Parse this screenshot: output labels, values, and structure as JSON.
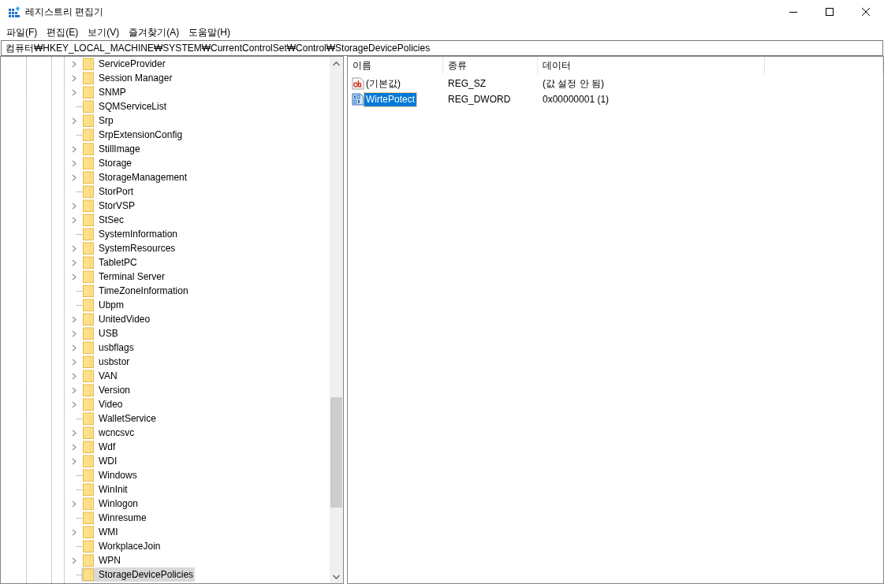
{
  "window": {
    "title": "레지스트리 편집기"
  },
  "menu": [
    "파일(F)",
    "편집(E)",
    "보기(V)",
    "즐겨찾기(A)",
    "도움말(H)"
  ],
  "address": "컴퓨터₩HKEY_LOCAL_MACHINE₩SYSTEM₩CurrentControlSet₩Control₩StorageDevicePolicies",
  "tree": [
    {
      "label": "ServiceProvider",
      "expandable": true,
      "selected": false
    },
    {
      "label": "Session Manager",
      "expandable": true,
      "selected": false
    },
    {
      "label": "SNMP",
      "expandable": true,
      "selected": false
    },
    {
      "label": "SQMServiceList",
      "expandable": false,
      "selected": false
    },
    {
      "label": "Srp",
      "expandable": true,
      "selected": false
    },
    {
      "label": "SrpExtensionConfig",
      "expandable": false,
      "selected": false
    },
    {
      "label": "StillImage",
      "expandable": true,
      "selected": false
    },
    {
      "label": "Storage",
      "expandable": true,
      "selected": false
    },
    {
      "label": "StorageManagement",
      "expandable": true,
      "selected": false
    },
    {
      "label": "StorPort",
      "expandable": false,
      "selected": false
    },
    {
      "label": "StorVSP",
      "expandable": true,
      "selected": false
    },
    {
      "label": "StSec",
      "expandable": true,
      "selected": false
    },
    {
      "label": "SystemInformation",
      "expandable": false,
      "selected": false
    },
    {
      "label": "SystemResources",
      "expandable": true,
      "selected": false
    },
    {
      "label": "TabletPC",
      "expandable": true,
      "selected": false
    },
    {
      "label": "Terminal Server",
      "expandable": true,
      "selected": false
    },
    {
      "label": "TimeZoneInformation",
      "expandable": false,
      "selected": false
    },
    {
      "label": "Ubpm",
      "expandable": false,
      "selected": false
    },
    {
      "label": "UnitedVideo",
      "expandable": true,
      "selected": false
    },
    {
      "label": "USB",
      "expandable": true,
      "selected": false
    },
    {
      "label": "usbflags",
      "expandable": true,
      "selected": false
    },
    {
      "label": "usbstor",
      "expandable": true,
      "selected": false
    },
    {
      "label": "VAN",
      "expandable": true,
      "selected": false
    },
    {
      "label": "Version",
      "expandable": true,
      "selected": false
    },
    {
      "label": "Video",
      "expandable": true,
      "selected": false
    },
    {
      "label": "WalletService",
      "expandable": false,
      "selected": false
    },
    {
      "label": "wcncsvc",
      "expandable": true,
      "selected": false
    },
    {
      "label": "Wdf",
      "expandable": true,
      "selected": false
    },
    {
      "label": "WDI",
      "expandable": true,
      "selected": false
    },
    {
      "label": "Windows",
      "expandable": false,
      "selected": false
    },
    {
      "label": "WinInit",
      "expandable": false,
      "selected": false
    },
    {
      "label": "Winlogon",
      "expandable": true,
      "selected": false
    },
    {
      "label": "Winresume",
      "expandable": false,
      "selected": false
    },
    {
      "label": "WMI",
      "expandable": true,
      "selected": false
    },
    {
      "label": "WorkplaceJoin",
      "expandable": false,
      "selected": false
    },
    {
      "label": "WPN",
      "expandable": true,
      "selected": false
    },
    {
      "label": "StorageDevicePolicies",
      "expandable": false,
      "selected": true
    }
  ],
  "values": {
    "columns": [
      "이름",
      "종류",
      "데이터"
    ],
    "rows": [
      {
        "kind": "string",
        "name": "(기본값)",
        "type": "REG_SZ",
        "data": "(값 설정 안 됨)",
        "selected": false
      },
      {
        "kind": "binary",
        "name": "WirtePotect",
        "type": "REG_DWORD",
        "data": "0x00000001 (1)",
        "selected": true
      }
    ]
  }
}
